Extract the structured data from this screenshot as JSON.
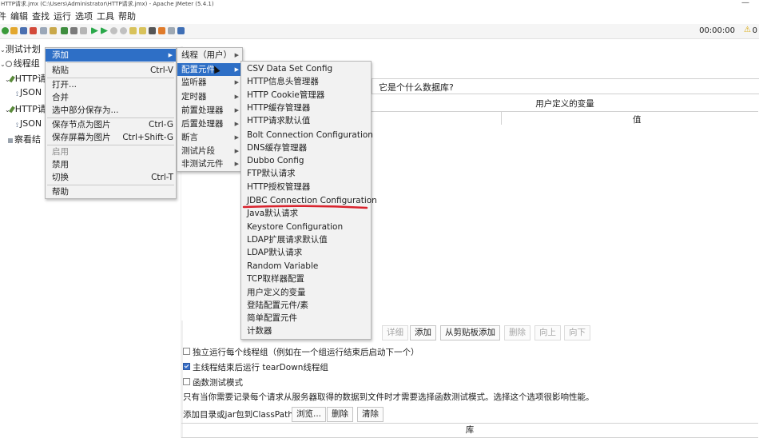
{
  "window": {
    "title": "HTTP请求.jmx (C:\\Users\\Administrator\\HTTP请求.jmx) - Apache JMeter (5.4.1)",
    "minimize": "—"
  },
  "menubar": [
    "件",
    "编辑",
    "查找",
    "运行",
    "选项",
    "工具",
    "帮助"
  ],
  "toolbar": {
    "timer": "00:00:00",
    "warning_icon": "warning-triangle-icon",
    "warning_count": "0"
  },
  "tree": {
    "items": [
      {
        "label": "测试计划",
        "icon": "test-plan-icon"
      },
      {
        "label": "线程组",
        "icon": "gear-icon"
      },
      {
        "label": "HTTP请",
        "icon": "pipette-icon"
      },
      {
        "label": "JSON",
        "icon": "extractor-icon"
      },
      {
        "label": "HTTP请",
        "icon": "pipette-icon"
      },
      {
        "label": "JSON",
        "icon": "extractor-icon"
      },
      {
        "label": "察看结",
        "icon": "listener-icon"
      }
    ]
  },
  "context_menu": {
    "items": [
      {
        "label": "添加",
        "accel": "",
        "submenu": true,
        "highlighted": true,
        "disabled": false
      },
      {
        "label": "粘贴",
        "accel": "Ctrl-V",
        "submenu": false,
        "highlighted": false,
        "disabled": false
      },
      {
        "label": "打开...",
        "accel": "",
        "submenu": false,
        "highlighted": false,
        "disabled": false
      },
      {
        "label": "合并",
        "accel": "",
        "submenu": false,
        "highlighted": false,
        "disabled": false
      },
      {
        "label": "选中部分保存为...",
        "accel": "",
        "submenu": false,
        "highlighted": false,
        "disabled": false
      },
      {
        "label": "保存节点为图片",
        "accel": "Ctrl-G",
        "submenu": false,
        "highlighted": false,
        "disabled": false
      },
      {
        "label": "保存屏幕为图片",
        "accel": "Ctrl+Shift-G",
        "submenu": false,
        "highlighted": false,
        "disabled": false
      },
      {
        "label": "启用",
        "accel": "",
        "submenu": false,
        "highlighted": false,
        "disabled": true
      },
      {
        "label": "禁用",
        "accel": "",
        "submenu": false,
        "highlighted": false,
        "disabled": false
      },
      {
        "label": "切换",
        "accel": "Ctrl-T",
        "submenu": false,
        "highlighted": false,
        "disabled": false
      },
      {
        "label": "帮助",
        "accel": "",
        "submenu": false,
        "highlighted": false,
        "disabled": false
      }
    ]
  },
  "add_submenu": {
    "items": [
      {
        "label": "线程（用户）",
        "highlighted": false
      },
      {
        "label": "配置元件",
        "highlighted": true
      },
      {
        "label": "监听器",
        "highlighted": false
      },
      {
        "label": "定时器",
        "highlighted": false
      },
      {
        "label": "前置处理器",
        "highlighted": false
      },
      {
        "label": "后置处理器",
        "highlighted": false
      },
      {
        "label": "断言",
        "highlighted": false
      },
      {
        "label": "测试片段",
        "highlighted": false
      },
      {
        "label": "非测试元件",
        "highlighted": false
      }
    ]
  },
  "config_submenu": {
    "items": [
      "CSV Data Set Config",
      "HTTP信息头管理器",
      "HTTP Cookie管理器",
      "HTTP缓存管理器",
      "HTTP请求默认值",
      "Bolt Connection Configuration",
      "DNS缓存管理器",
      "Dubbo Config",
      "FTP默认请求",
      "HTTP授权管理器",
      "JDBC Connection Configuration",
      "Java默认请求",
      "Keystore Configuration",
      "LDAP扩展请求默认值",
      "LDAP默认请求",
      "Random Variable",
      "TCP取样器配置",
      "用户定义的变量",
      "登陆配置元件/素",
      "简单配置元件",
      "计数器"
    ],
    "underlined": "JDBC Connection Configuration",
    "underline_color": "#d9232d"
  },
  "main": {
    "comment_text": "它是个什么数据库?",
    "user_vars_title": "用户定义的变量",
    "value_header": "值",
    "buttons": [
      {
        "label": "详细",
        "disabled": true
      },
      {
        "label": "添加",
        "disabled": false
      },
      {
        "label": "从剪贴板添加",
        "disabled": false
      },
      {
        "label": "删除",
        "disabled": true
      },
      {
        "label": "向上",
        "disabled": true
      },
      {
        "label": "向下",
        "disabled": true
      }
    ],
    "options": [
      {
        "label": "独立运行每个线程组（例如在一个组运行结束后启动下一个）",
        "checked": false
      },
      {
        "label": "主线程结束后运行 tearDown线程组",
        "checked": true
      },
      {
        "label": "函数测试模式",
        "checked": false
      }
    ],
    "note": "只有当你需要记录每个请求从服务器取得的数据到文件时才需要选择函数测试模式。选择这个选项很影响性能。",
    "classpath_label": "添加目录或jar包到ClassPath",
    "classpath_buttons": [
      "浏览...",
      "删除",
      "清除"
    ],
    "library_header": "库"
  }
}
